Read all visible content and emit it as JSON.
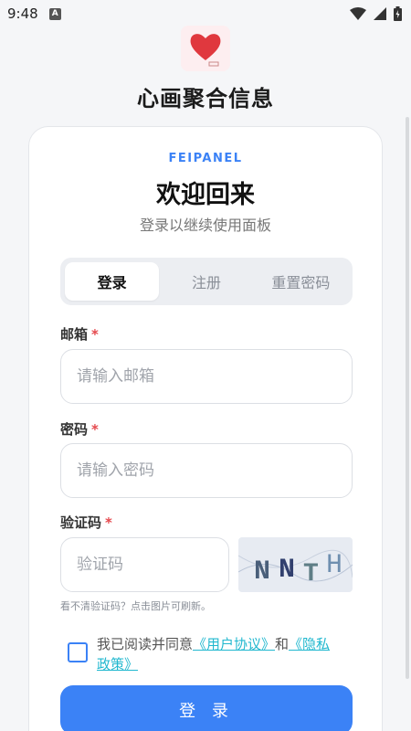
{
  "status_bar": {
    "time": "9:48",
    "notification_badge": "A"
  },
  "app": {
    "title": "心画聚合信息",
    "logo_icon": "heart-logo-icon"
  },
  "card": {
    "brand": "FEIPANEL",
    "welcome": "欢迎回来",
    "subtitle": "登录以继续使用面板"
  },
  "tabs": [
    {
      "label": "登录",
      "active": true
    },
    {
      "label": "注册",
      "active": false
    },
    {
      "label": "重置密码",
      "active": false
    }
  ],
  "form": {
    "email": {
      "label": "邮箱",
      "required_mark": "*",
      "placeholder": "请输入邮箱"
    },
    "password": {
      "label": "密码",
      "required_mark": "*",
      "placeholder": "请输入密码"
    },
    "captcha": {
      "label": "验证码",
      "required_mark": "*",
      "placeholder": "验证码",
      "image_text": [
        "N",
        "N",
        "T",
        "H"
      ],
      "hint": "看不清验证码？点击图片可刷新。"
    }
  },
  "agreement": {
    "prefix": "我已阅读并同意",
    "user_agreement": "《用户协议》",
    "and": "和",
    "privacy_policy": "《隐私政策》"
  },
  "login_button": "登 录",
  "colors": {
    "accent": "#3b82f6",
    "link": "#22b8cf",
    "required": "#e5484d"
  }
}
